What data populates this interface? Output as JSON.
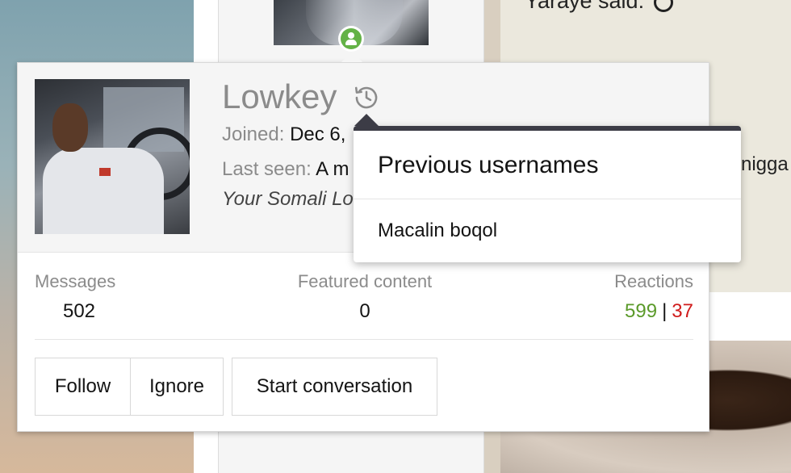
{
  "background": {
    "said_text": "Yaraye said:",
    "side_text": "nigga"
  },
  "card": {
    "username": "Lowkey",
    "joined_label": "Joined:",
    "joined_value": "Dec 6,",
    "last_seen_label": "Last seen:",
    "last_seen_value": "A m",
    "user_title": "Your Somali Lo",
    "stats": {
      "messages_label": "Messages",
      "messages_value": "502",
      "featured_label": "Featured content",
      "featured_value": "0",
      "reactions_label": "Reactions",
      "reactions_positive": "599",
      "reactions_separator": "|",
      "reactions_negative": "37"
    },
    "buttons": {
      "follow": "Follow",
      "ignore": "Ignore",
      "start_conversation": "Start conversation"
    }
  },
  "previous_usernames": {
    "title": "Previous usernames",
    "items": [
      "Macalin boqol"
    ]
  },
  "colors": {
    "positive": "#5b9a2a",
    "negative": "#d01b1b",
    "online": "#63b246",
    "popup_border": "#3c3c46"
  },
  "icons": {
    "history": "history-icon",
    "online": "online-user-icon"
  }
}
